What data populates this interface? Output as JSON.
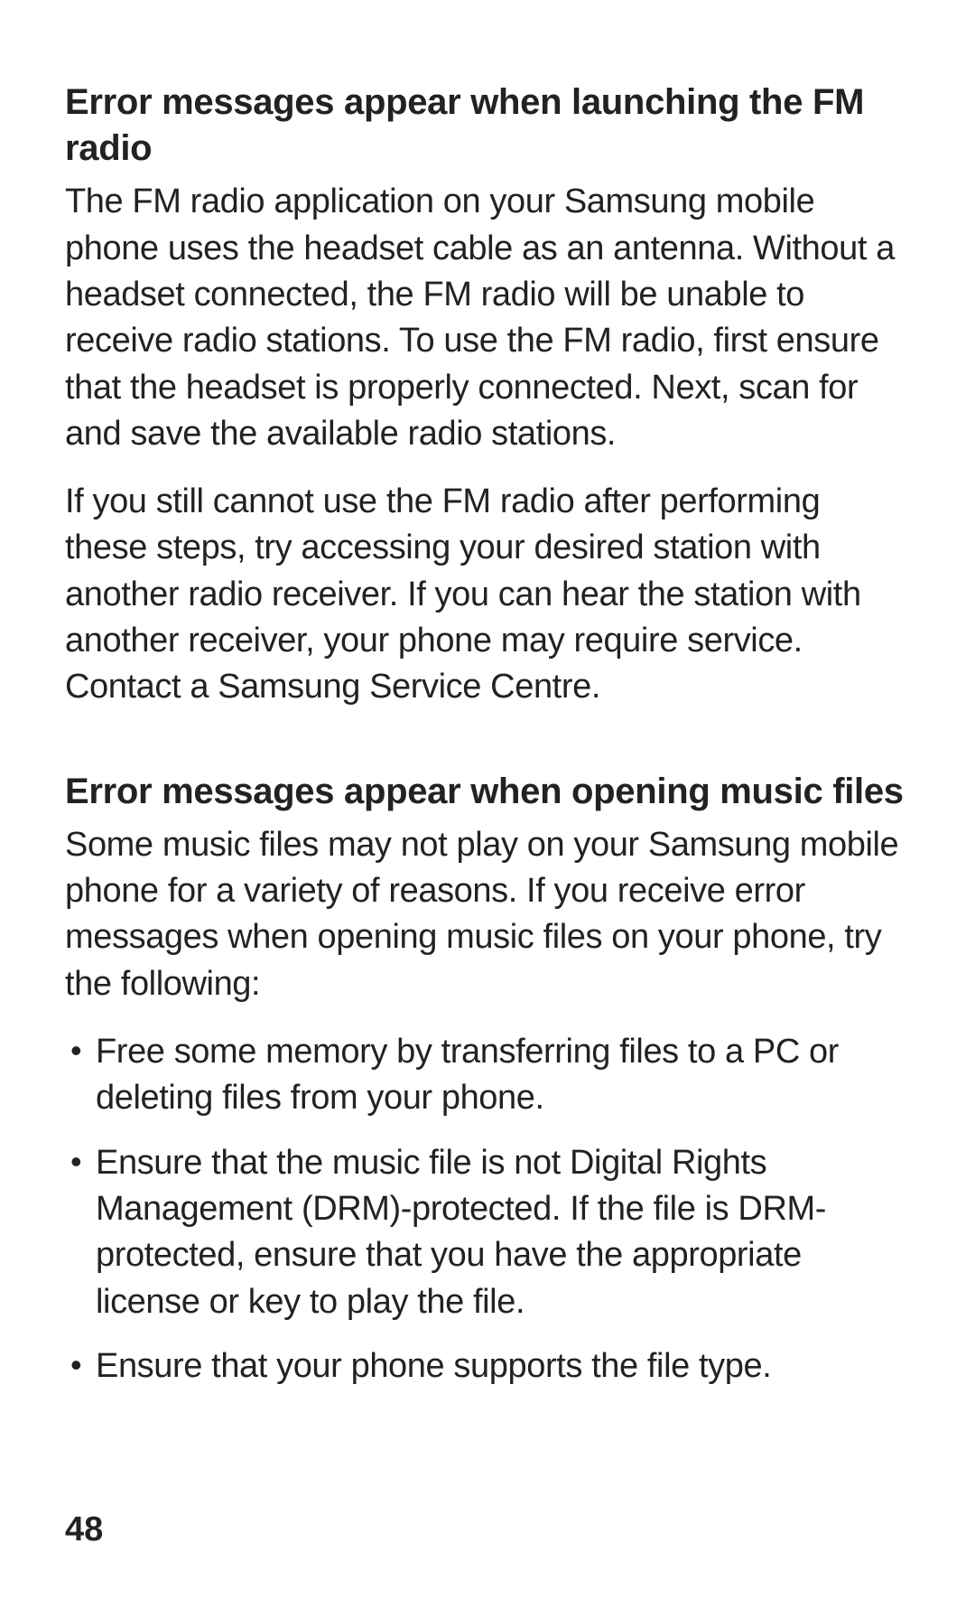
{
  "section1": {
    "heading": "Error messages appear when launching the FM radio",
    "para1": "The FM radio application on your Samsung mobile phone uses the headset cable as an antenna. Without a headset connected, the FM radio will be unable to receive radio stations. To use the FM radio, first ensure that the headset is properly connected. Next, scan for and save the available radio stations.",
    "para2": "If you still cannot use the FM radio after performing these steps, try accessing your desired station with another radio receiver. If you can hear the station with another receiver, your phone may require service. Contact a Samsung Service Centre."
  },
  "section2": {
    "heading": "Error messages appear when opening music files",
    "para1": "Some music files may not play on your Samsung mobile phone for a variety of reasons. If you receive error messages when opening music files on your phone, try the following:",
    "bullets": [
      "Free some memory by transferring files to a PC or deleting files from your phone.",
      "Ensure that the music file is not Digital Rights Management (DRM)-protected. If the file is DRM-protected, ensure that you have the appropriate license or key to play the file.",
      "Ensure that your phone supports the file type."
    ]
  },
  "page_number": "48"
}
